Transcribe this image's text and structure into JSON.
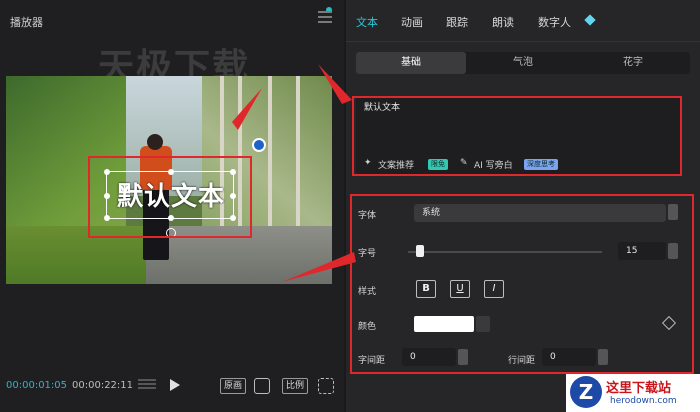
{
  "player": {
    "title": "播放器",
    "watermark": "天极下载",
    "overlay_text": "默认文本",
    "time_current": "00:00:01:05",
    "time_total": "00:00:22:11",
    "btn_original": "原画",
    "btn_ratio": "比例"
  },
  "tabs": [
    {
      "label": "文本",
      "active": true
    },
    {
      "label": "动画"
    },
    {
      "label": "跟踪"
    },
    {
      "label": "朗读"
    },
    {
      "label": "数字人"
    }
  ],
  "subtabs": [
    {
      "label": "基础",
      "active": true
    },
    {
      "label": "气泡"
    },
    {
      "label": "花字"
    }
  ],
  "text_input": {
    "value": "默认文本",
    "tool_recommend": "文案推荐",
    "badge_free": "限免",
    "tool_ai": "AI 写旁白",
    "badge_deep": "深度思考"
  },
  "props": {
    "font_label": "字体",
    "font_value": "系统",
    "size_label": "字号",
    "size_value": "15",
    "size_level": 0.04,
    "style_label": "样式",
    "style_buttons": [
      "B",
      "U",
      "I"
    ],
    "color_label": "颜色",
    "color_value": "#ffffff",
    "letter_spacing_label": "字间距",
    "letter_spacing_value": "0",
    "line_spacing_label": "行间距",
    "line_spacing_value": "0"
  },
  "logo": {
    "letter": "Z",
    "text": "这里下载站",
    "sub": "herodown.com"
  },
  "colors": {
    "accent": "#2fc4d2",
    "annotation": "#e0282c"
  }
}
